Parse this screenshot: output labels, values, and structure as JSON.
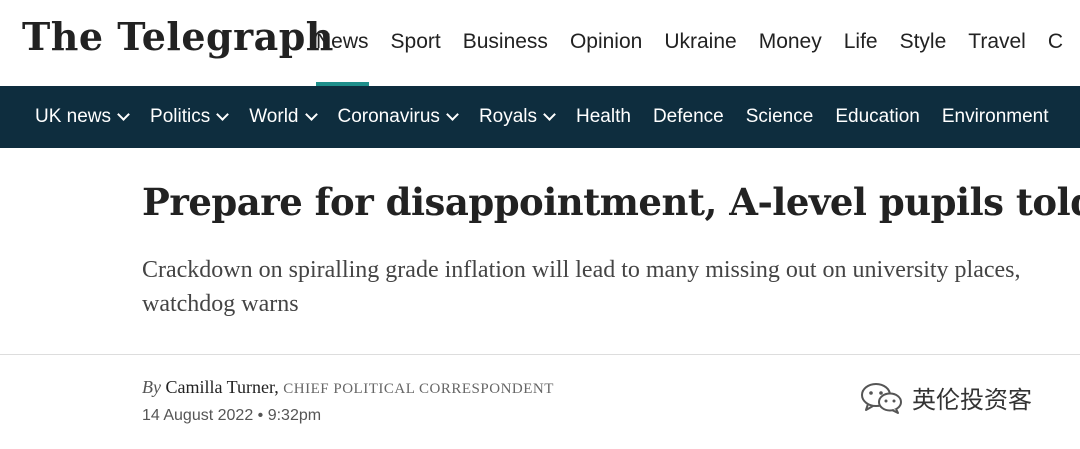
{
  "header": {
    "logo": "The Telegraph",
    "nav": [
      "News",
      "Sport",
      "Business",
      "Opinion",
      "Ukraine",
      "Money",
      "Life",
      "Style",
      "Travel",
      "C"
    ],
    "active_nav": "News"
  },
  "subnav": {
    "items": [
      {
        "label": "UK news",
        "dropdown": true
      },
      {
        "label": "Politics",
        "dropdown": true
      },
      {
        "label": "World",
        "dropdown": true
      },
      {
        "label": "Coronavirus",
        "dropdown": true
      },
      {
        "label": "Royals",
        "dropdown": true
      },
      {
        "label": "Health",
        "dropdown": false
      },
      {
        "label": "Defence",
        "dropdown": false
      },
      {
        "label": "Science",
        "dropdown": false
      },
      {
        "label": "Education",
        "dropdown": false
      },
      {
        "label": "Environment",
        "dropdown": false
      }
    ]
  },
  "article": {
    "headline": "Prepare for disappointment, A-level pupils told",
    "standfirst": "Crackdown on spiralling grade inflation will lead to many missing out on university places, watchdog warns",
    "by": "By",
    "author": "Camilla Turner,",
    "role": "CHIEF POLITICAL CORRESPONDENT",
    "date": "14 August 2022 • 9:32pm"
  },
  "watermark": {
    "text": "英伦投资客",
    "icon": "wechat-icon"
  },
  "colors": {
    "subnav_bg": "#0e2d3e",
    "active_underline": "#1f8f8b"
  }
}
